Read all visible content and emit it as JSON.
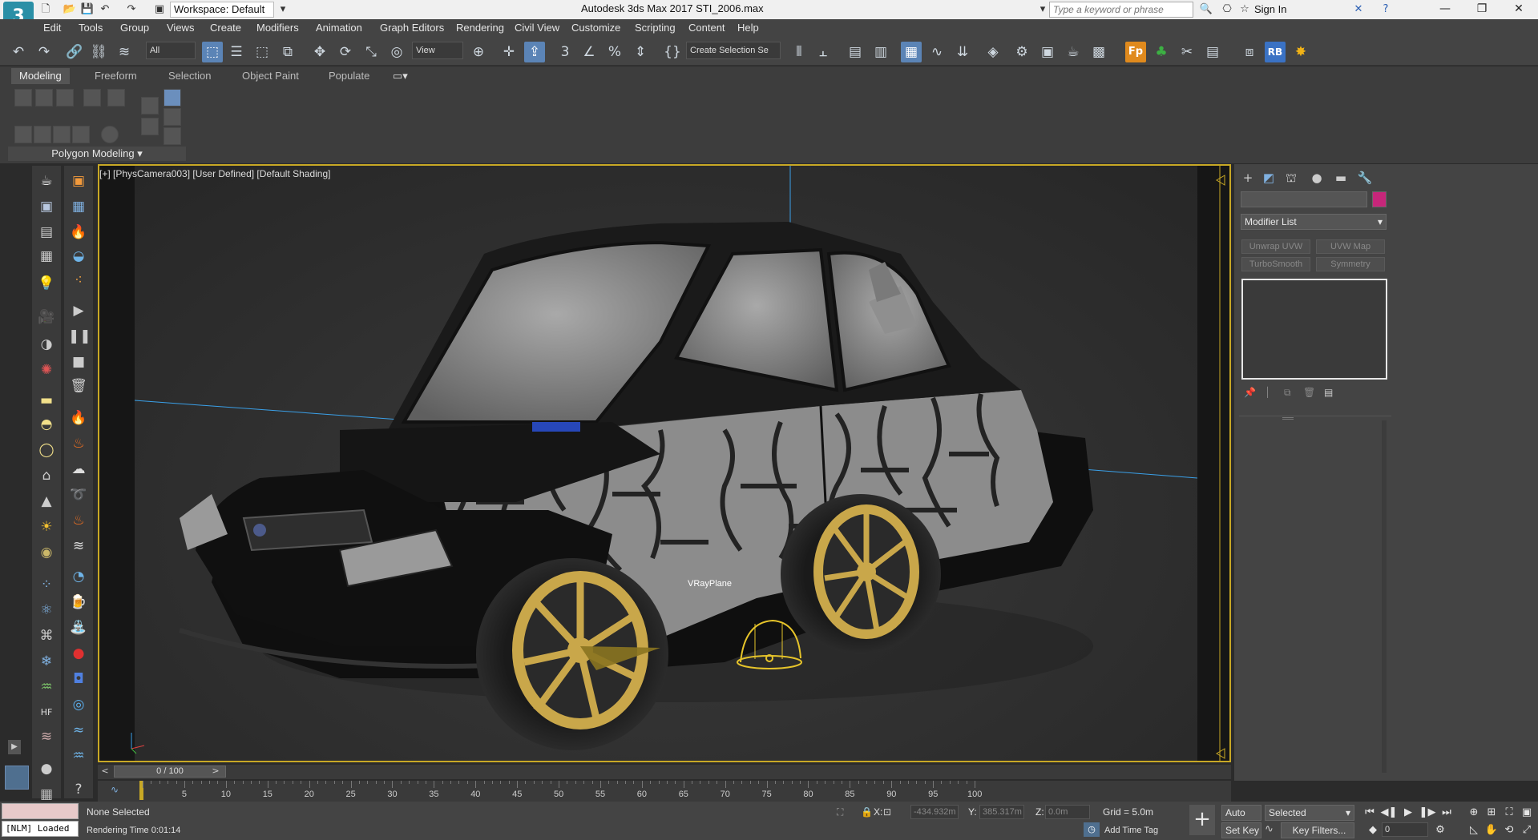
{
  "titlebar": {
    "workspace": "Workspace: Default",
    "window_title": "Autodesk 3ds Max 2017     STI_2006.max",
    "search_placeholder": "Type a keyword or phrase",
    "sign_in": "Sign In"
  },
  "menu": [
    "Edit",
    "Tools",
    "Group",
    "Views",
    "Create",
    "Modifiers",
    "Animation",
    "Graph Editors",
    "Rendering",
    "Civil View",
    "Customize",
    "Scripting",
    "Content",
    "Help"
  ],
  "toolbar": {
    "selection_filter": "All",
    "ref_coord": "View",
    "named_selection": "Create Selection Se",
    "fp_label": "Fp",
    "rb_label": "RB"
  },
  "ribbon": {
    "tabs": [
      "Modeling",
      "Freeform",
      "Selection",
      "Object Paint",
      "Populate"
    ],
    "panel_title": "Polygon Modeling"
  },
  "viewport": {
    "label": "[+] [PhysCamera003] [User Defined] [Default Shading]",
    "vrayplane_label": "VRayPlane"
  },
  "command_panel": {
    "modifier_list": "Modifier List",
    "modifier_buttons": [
      "Unwrap UVW",
      "UVW Map",
      "TurboSmooth",
      "Symmetry"
    ],
    "object_color": "#c6267a"
  },
  "timeline": {
    "frame_display": "0 / 100",
    "ticks": [
      "5",
      "10",
      "15",
      "20",
      "25",
      "30",
      "35",
      "40",
      "45",
      "50",
      "55",
      "60",
      "65",
      "70",
      "75",
      "80",
      "85",
      "90",
      "95",
      "100"
    ]
  },
  "status": {
    "nlm": "[NLM] Loaded",
    "selection": "None Selected",
    "render_time": "Rendering Time  0:01:14",
    "x_label": "X:",
    "x_value": "-434.932m",
    "y_label": "Y:",
    "y_value": "385.317m",
    "z_label": "Z:",
    "z_value": "0.0m",
    "grid": "Grid = 5.0m",
    "add_time_tag": "Add Time Tag",
    "auto_key": "Auto Key",
    "set_key": "Set Key",
    "key_mode": "Selected",
    "key_filters": "Key Filters...",
    "current_frame": "0"
  },
  "colors": {
    "accent": "#5b84b6",
    "viewport_border": "#c8a825",
    "rim_gold": "#c9a74a"
  }
}
